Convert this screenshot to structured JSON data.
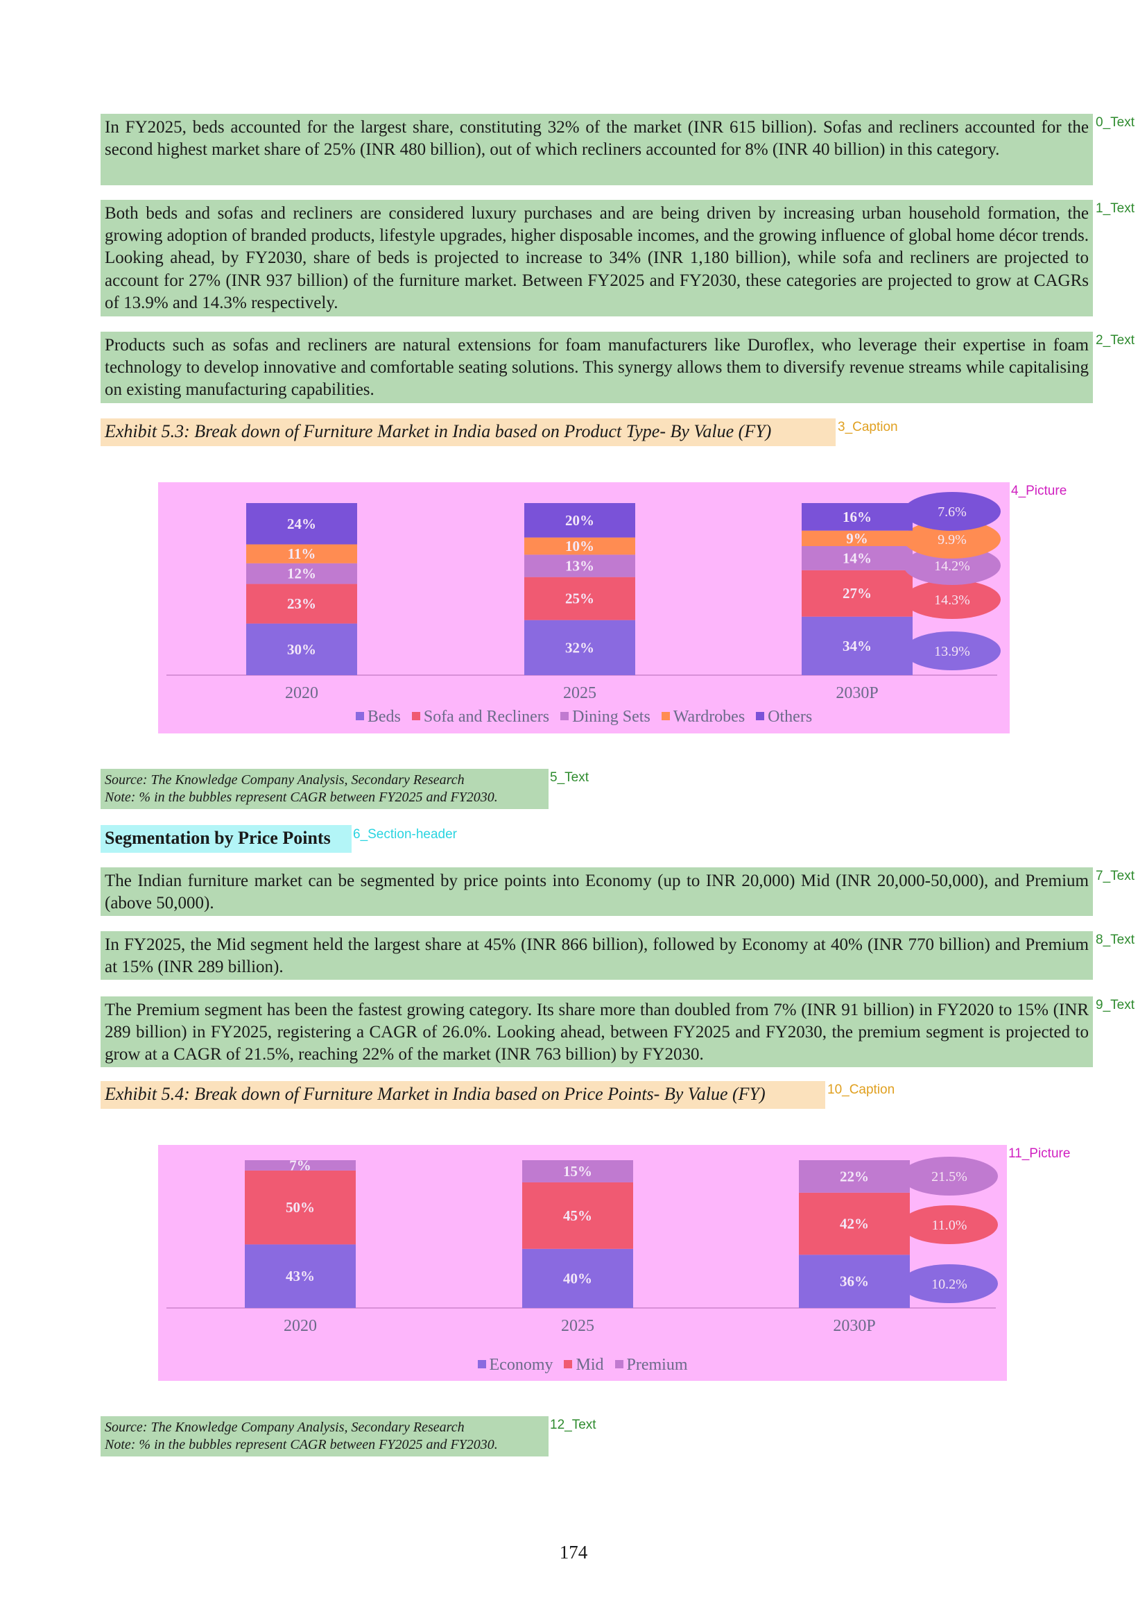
{
  "blocks": {
    "p0": {
      "tag": "0_Text",
      "text": "In FY2025, beds accounted for the largest share, constituting 32% of the market (INR 615 billion). Sofas and recliners accounted for the second highest market share of 25% (INR 480 billion), out of which recliners accounted for 8% (INR 40 billion) in this category."
    },
    "p1": {
      "tag": "1_Text",
      "text": "Both beds and sofas and recliners are considered luxury purchases and are being driven by increasing urban household formation, the growing adoption of branded products, lifestyle upgrades, higher disposable incomes, and the growing influence of global home décor trends. Looking ahead, by FY2030, share of beds is projected to increase to 34% (INR 1,180 billion), while sofa and recliners are projected to account for 27% (INR 937 billion) of the furniture market. Between FY2025 and FY2030, these categories are projected to grow at CAGRs of 13.9% and 14.3% respectively."
    },
    "p2": {
      "tag": "2_Text",
      "text": "Products such as sofas and recliners are natural extensions for foam manufacturers like Duroflex, who leverage their expertise in foam technology to develop innovative and comfortable seating solutions. This synergy allows them to diversify revenue streams while capitalising on existing manufacturing capabilities."
    },
    "cap3": {
      "tag": "3_Caption",
      "text": "Exhibit 5.3: Break down of Furniture Market in India based on Product Type- By Value (FY)"
    },
    "pic4": {
      "tag": "4_Picture"
    },
    "src5": {
      "tag": "5_Text",
      "line1": "Source: The Knowledge Company Analysis, Secondary Research",
      "line2": "Note: % in the bubbles represent CAGR between FY2025 and FY2030."
    },
    "sec6": {
      "tag": "6_Section-header",
      "text": "Segmentation by Price Points"
    },
    "p7": {
      "tag": "7_Text",
      "text": "The Indian furniture market can be segmented by price points into Economy (up to INR 20,000) Mid (INR 20,000-50,000), and Premium (above 50,000)."
    },
    "p8": {
      "tag": "8_Text",
      "text": "In FY2025, the Mid segment held the largest share at 45% (INR 866 billion), followed by Economy at 40% (INR 770 billion) and Premium at 15% (INR 289 billion)."
    },
    "p9": {
      "tag": "9_Text",
      "text": "The Premium segment has been the fastest growing category. Its share more than doubled from 7% (INR 91 billion) in FY2020 to 15% (INR 289 billion) in FY2025, registering a CAGR of 26.0%. Looking ahead, between FY2025 and FY2030, the premium segment is projected to grow at a CAGR of 21.5%, reaching 22% of the market (INR 763 billion) by FY2030."
    },
    "cap10": {
      "tag": "10_Caption",
      "text": "Exhibit 5.4: Break down of Furniture Market in India based on Price Points- By Value (FY)"
    },
    "pic11": {
      "tag": "11_Picture"
    },
    "src12": {
      "tag": "12_Text",
      "line1": "Source: The Knowledge Company Analysis, Secondary Research",
      "line2": "Note: % in the bubbles represent CAGR between FY2025 and FY2030."
    }
  },
  "page_number": "174",
  "chart_data": [
    {
      "type": "bar",
      "stacked": true,
      "percent_stacked": true,
      "categories": [
        "2020",
        "2025",
        "2030P"
      ],
      "series": [
        {
          "name": "Beds",
          "values": [
            30,
            32,
            34
          ],
          "color": "#8a6ae0",
          "cagr": "13.9%",
          "bubble_color": "#8a6ae0"
        },
        {
          "name": "Sofa and Recliners",
          "values": [
            23,
            25,
            27
          ],
          "color": "#f05a72",
          "cagr": "14.3%",
          "bubble_color": "#f05a72"
        },
        {
          "name": "Dining Sets",
          "values": [
            12,
            13,
            14
          ],
          "color": "#c07ad0",
          "cagr": "14.2%",
          "bubble_color": "#c07ad0"
        },
        {
          "name": "Wardrobes",
          "values": [
            11,
            10,
            9
          ],
          "color": "#ff8c52",
          "cagr": "9.9%",
          "bubble_color": "#ff8c52"
        },
        {
          "name": "Others",
          "values": [
            24,
            20,
            16
          ],
          "color": "#7a52d8",
          "cagr": "7.6%",
          "bubble_color": "#7a52d8"
        }
      ],
      "labels": [
        [
          "30%",
          "32%",
          "34%"
        ],
        [
          "23%",
          "25%",
          "27%"
        ],
        [
          "12%",
          "13%",
          "14%"
        ],
        [
          "11%",
          "10%",
          "9%"
        ],
        [
          "24%",
          "20%",
          "16%"
        ]
      ],
      "legend_position": "bottom",
      "grid": false,
      "background": "#fdb6fb"
    },
    {
      "type": "bar",
      "stacked": true,
      "percent_stacked": true,
      "categories": [
        "2020",
        "2025",
        "2030P"
      ],
      "series": [
        {
          "name": "Economy",
          "values": [
            43,
            40,
            36
          ],
          "color": "#8a6ae0",
          "cagr": "10.2%",
          "bubble_color": "#8a6ae0"
        },
        {
          "name": "Mid",
          "values": [
            50,
            45,
            42
          ],
          "color": "#f05a72",
          "cagr": "11.0%",
          "bubble_color": "#f05a72"
        },
        {
          "name": "Premium",
          "values": [
            7,
            15,
            22
          ],
          "color": "#c07ad0",
          "cagr": "21.5%",
          "bubble_color": "#c07ad0"
        }
      ],
      "labels": [
        [
          "43%",
          "40%",
          "36%"
        ],
        [
          "50%",
          "45%",
          "42%"
        ],
        [
          "7%",
          "15%",
          "22%"
        ]
      ],
      "legend_position": "bottom",
      "grid": false,
      "background": "#fdb6fb"
    }
  ]
}
